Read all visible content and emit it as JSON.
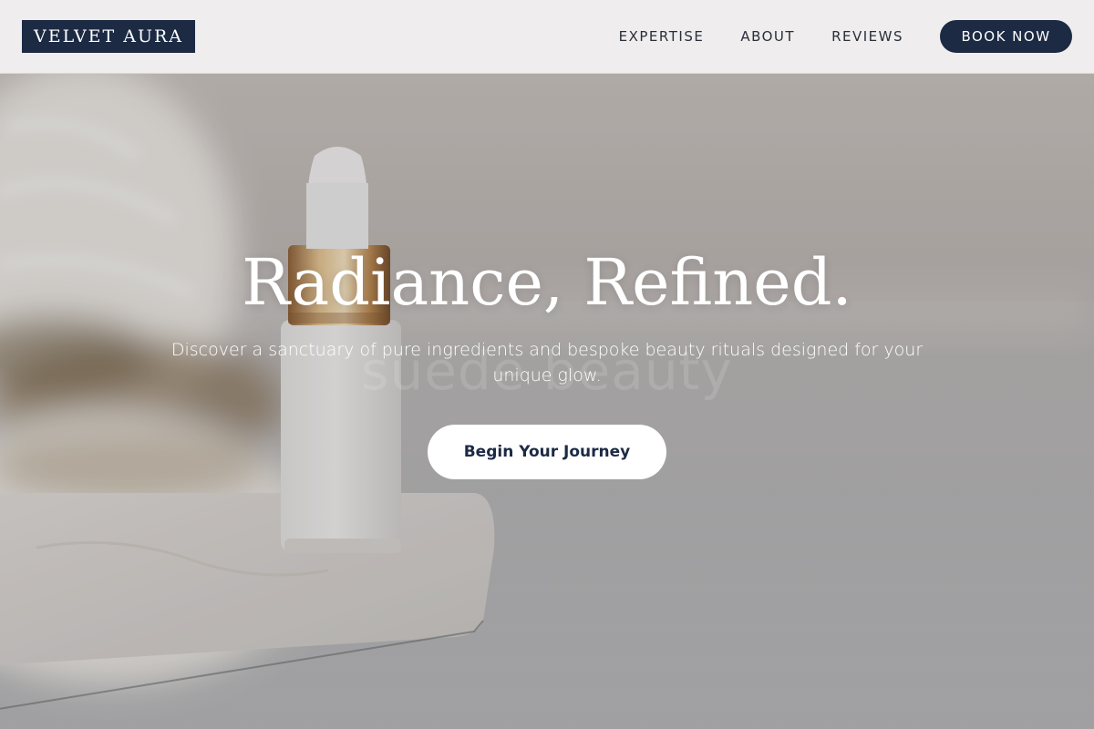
{
  "brand": {
    "name": "VELVET AURA"
  },
  "nav": {
    "items": [
      {
        "label": "EXPERTISE"
      },
      {
        "label": "ABOUT"
      },
      {
        "label": "REVIEWS"
      }
    ],
    "cta_label": "BOOK NOW"
  },
  "hero": {
    "title": "Radiance, Refined.",
    "subtitle": "Discover a sanctuary of pure ingredients and bespoke beauty rituals designed for your unique glow.",
    "cta_label": "Begin Your Journey",
    "watermark": "suede beauty"
  },
  "colors": {
    "primary": "#1c2a44",
    "header_bg": "#efeded",
    "button_text": "#ffffff",
    "accent_gold": "#b8874e"
  }
}
